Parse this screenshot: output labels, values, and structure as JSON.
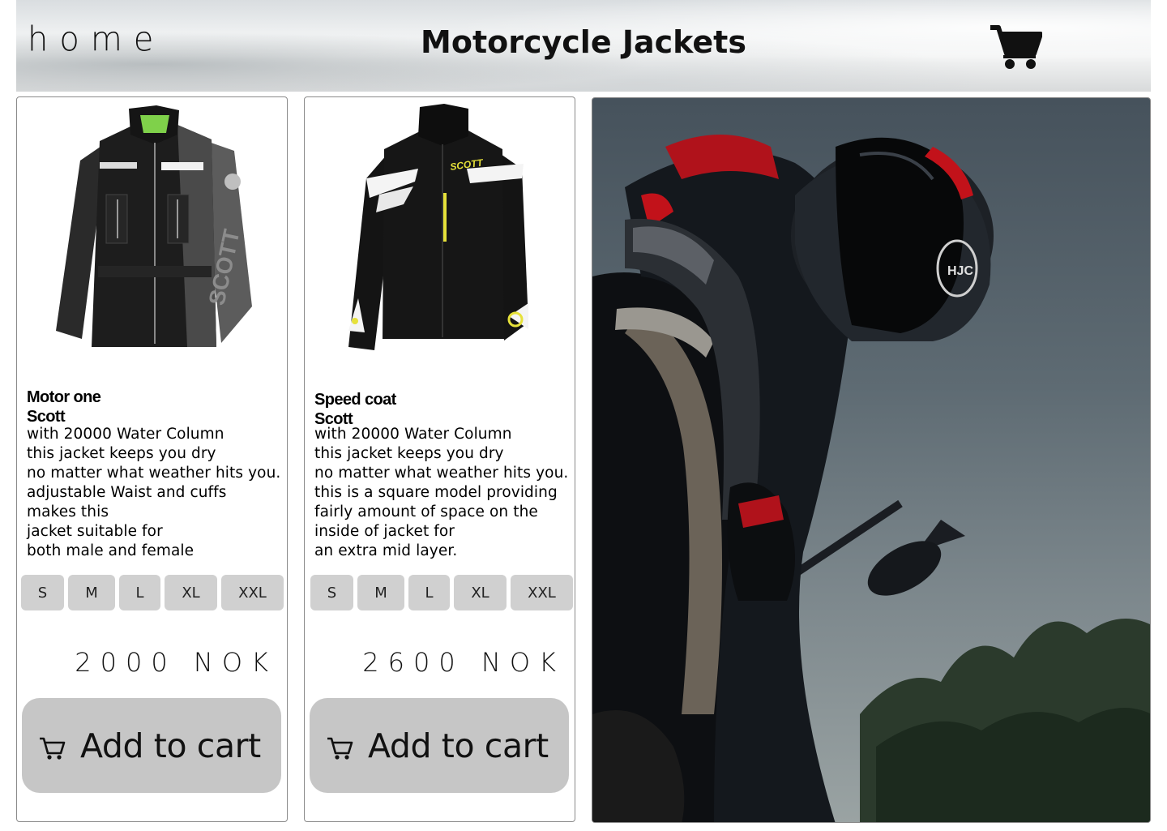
{
  "header": {
    "home_label": "Home",
    "title": "Motorcycle Jackets",
    "cart_icon": "shopping-cart-icon"
  },
  "products": [
    {
      "name": "Motor one",
      "brand": "Scott",
      "description": [
        "with 20000 Water Column",
        "this jacket keeps you dry",
        "no matter what weather hits you.",
        "adjustable Waist and cuffs",
        "makes this",
        "jacket suitable for",
        "both male and female"
      ],
      "sizes": [
        "S",
        "M",
        "L",
        "XL",
        "XXL"
      ],
      "price": "2000 NOK",
      "add_to_cart": "Add to cart",
      "colors": {
        "body": "#1c1c1c",
        "sleeve": "#5a5a5a",
        "accent": "#7fd14a"
      }
    },
    {
      "name": "Speed coat",
      "brand": "Scott",
      "description": [
        "with 20000 Water Column",
        "this jacket keeps you dry",
        "no matter what weather hits you.",
        "this is a square model providing",
        "fairly amount of space on the",
        "inside of jacket for",
        "an extra mid layer."
      ],
      "sizes": [
        "S",
        "M",
        "L",
        "XL",
        "XXL"
      ],
      "price": "2600 NOK",
      "add_to_cart": "Add to cart",
      "colors": {
        "body": "#141414",
        "stripe": "#ffffff",
        "accent": "#e6e13a"
      }
    }
  ],
  "hero": {
    "subject": "motorcycle-rider-photo",
    "colors": {
      "sky": "#55626b",
      "suit": "#15191e",
      "accent": "#c2121a"
    }
  },
  "theme": {
    "button_bg": "#c6c6c6",
    "size_bg": "#d0d0d0",
    "border": "#8a8a8a"
  }
}
